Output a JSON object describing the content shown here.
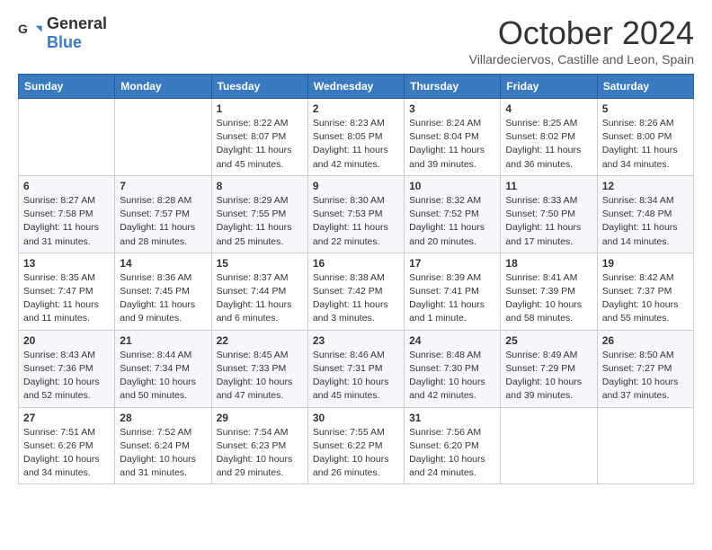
{
  "header": {
    "logo_general": "General",
    "logo_blue": "Blue",
    "month_title": "October 2024",
    "subtitle": "Villardeciervos, Castille and Leon, Spain"
  },
  "weekdays": [
    "Sunday",
    "Monday",
    "Tuesday",
    "Wednesday",
    "Thursday",
    "Friday",
    "Saturday"
  ],
  "weeks": [
    [
      {
        "day": "",
        "info": ""
      },
      {
        "day": "",
        "info": ""
      },
      {
        "day": "1",
        "info": "Sunrise: 8:22 AM\nSunset: 8:07 PM\nDaylight: 11 hours and 45 minutes."
      },
      {
        "day": "2",
        "info": "Sunrise: 8:23 AM\nSunset: 8:05 PM\nDaylight: 11 hours and 42 minutes."
      },
      {
        "day": "3",
        "info": "Sunrise: 8:24 AM\nSunset: 8:04 PM\nDaylight: 11 hours and 39 minutes."
      },
      {
        "day": "4",
        "info": "Sunrise: 8:25 AM\nSunset: 8:02 PM\nDaylight: 11 hours and 36 minutes."
      },
      {
        "day": "5",
        "info": "Sunrise: 8:26 AM\nSunset: 8:00 PM\nDaylight: 11 hours and 34 minutes."
      }
    ],
    [
      {
        "day": "6",
        "info": "Sunrise: 8:27 AM\nSunset: 7:58 PM\nDaylight: 11 hours and 31 minutes."
      },
      {
        "day": "7",
        "info": "Sunrise: 8:28 AM\nSunset: 7:57 PM\nDaylight: 11 hours and 28 minutes."
      },
      {
        "day": "8",
        "info": "Sunrise: 8:29 AM\nSunset: 7:55 PM\nDaylight: 11 hours and 25 minutes."
      },
      {
        "day": "9",
        "info": "Sunrise: 8:30 AM\nSunset: 7:53 PM\nDaylight: 11 hours and 22 minutes."
      },
      {
        "day": "10",
        "info": "Sunrise: 8:32 AM\nSunset: 7:52 PM\nDaylight: 11 hours and 20 minutes."
      },
      {
        "day": "11",
        "info": "Sunrise: 8:33 AM\nSunset: 7:50 PM\nDaylight: 11 hours and 17 minutes."
      },
      {
        "day": "12",
        "info": "Sunrise: 8:34 AM\nSunset: 7:48 PM\nDaylight: 11 hours and 14 minutes."
      }
    ],
    [
      {
        "day": "13",
        "info": "Sunrise: 8:35 AM\nSunset: 7:47 PM\nDaylight: 11 hours and 11 minutes."
      },
      {
        "day": "14",
        "info": "Sunrise: 8:36 AM\nSunset: 7:45 PM\nDaylight: 11 hours and 9 minutes."
      },
      {
        "day": "15",
        "info": "Sunrise: 8:37 AM\nSunset: 7:44 PM\nDaylight: 11 hours and 6 minutes."
      },
      {
        "day": "16",
        "info": "Sunrise: 8:38 AM\nSunset: 7:42 PM\nDaylight: 11 hours and 3 minutes."
      },
      {
        "day": "17",
        "info": "Sunrise: 8:39 AM\nSunset: 7:41 PM\nDaylight: 11 hours and 1 minute."
      },
      {
        "day": "18",
        "info": "Sunrise: 8:41 AM\nSunset: 7:39 PM\nDaylight: 10 hours and 58 minutes."
      },
      {
        "day": "19",
        "info": "Sunrise: 8:42 AM\nSunset: 7:37 PM\nDaylight: 10 hours and 55 minutes."
      }
    ],
    [
      {
        "day": "20",
        "info": "Sunrise: 8:43 AM\nSunset: 7:36 PM\nDaylight: 10 hours and 52 minutes."
      },
      {
        "day": "21",
        "info": "Sunrise: 8:44 AM\nSunset: 7:34 PM\nDaylight: 10 hours and 50 minutes."
      },
      {
        "day": "22",
        "info": "Sunrise: 8:45 AM\nSunset: 7:33 PM\nDaylight: 10 hours and 47 minutes."
      },
      {
        "day": "23",
        "info": "Sunrise: 8:46 AM\nSunset: 7:31 PM\nDaylight: 10 hours and 45 minutes."
      },
      {
        "day": "24",
        "info": "Sunrise: 8:48 AM\nSunset: 7:30 PM\nDaylight: 10 hours and 42 minutes."
      },
      {
        "day": "25",
        "info": "Sunrise: 8:49 AM\nSunset: 7:29 PM\nDaylight: 10 hours and 39 minutes."
      },
      {
        "day": "26",
        "info": "Sunrise: 8:50 AM\nSunset: 7:27 PM\nDaylight: 10 hours and 37 minutes."
      }
    ],
    [
      {
        "day": "27",
        "info": "Sunrise: 7:51 AM\nSunset: 6:26 PM\nDaylight: 10 hours and 34 minutes."
      },
      {
        "day": "28",
        "info": "Sunrise: 7:52 AM\nSunset: 6:24 PM\nDaylight: 10 hours and 31 minutes."
      },
      {
        "day": "29",
        "info": "Sunrise: 7:54 AM\nSunset: 6:23 PM\nDaylight: 10 hours and 29 minutes."
      },
      {
        "day": "30",
        "info": "Sunrise: 7:55 AM\nSunset: 6:22 PM\nDaylight: 10 hours and 26 minutes."
      },
      {
        "day": "31",
        "info": "Sunrise: 7:56 AM\nSunset: 6:20 PM\nDaylight: 10 hours and 24 minutes."
      },
      {
        "day": "",
        "info": ""
      },
      {
        "day": "",
        "info": ""
      }
    ]
  ]
}
